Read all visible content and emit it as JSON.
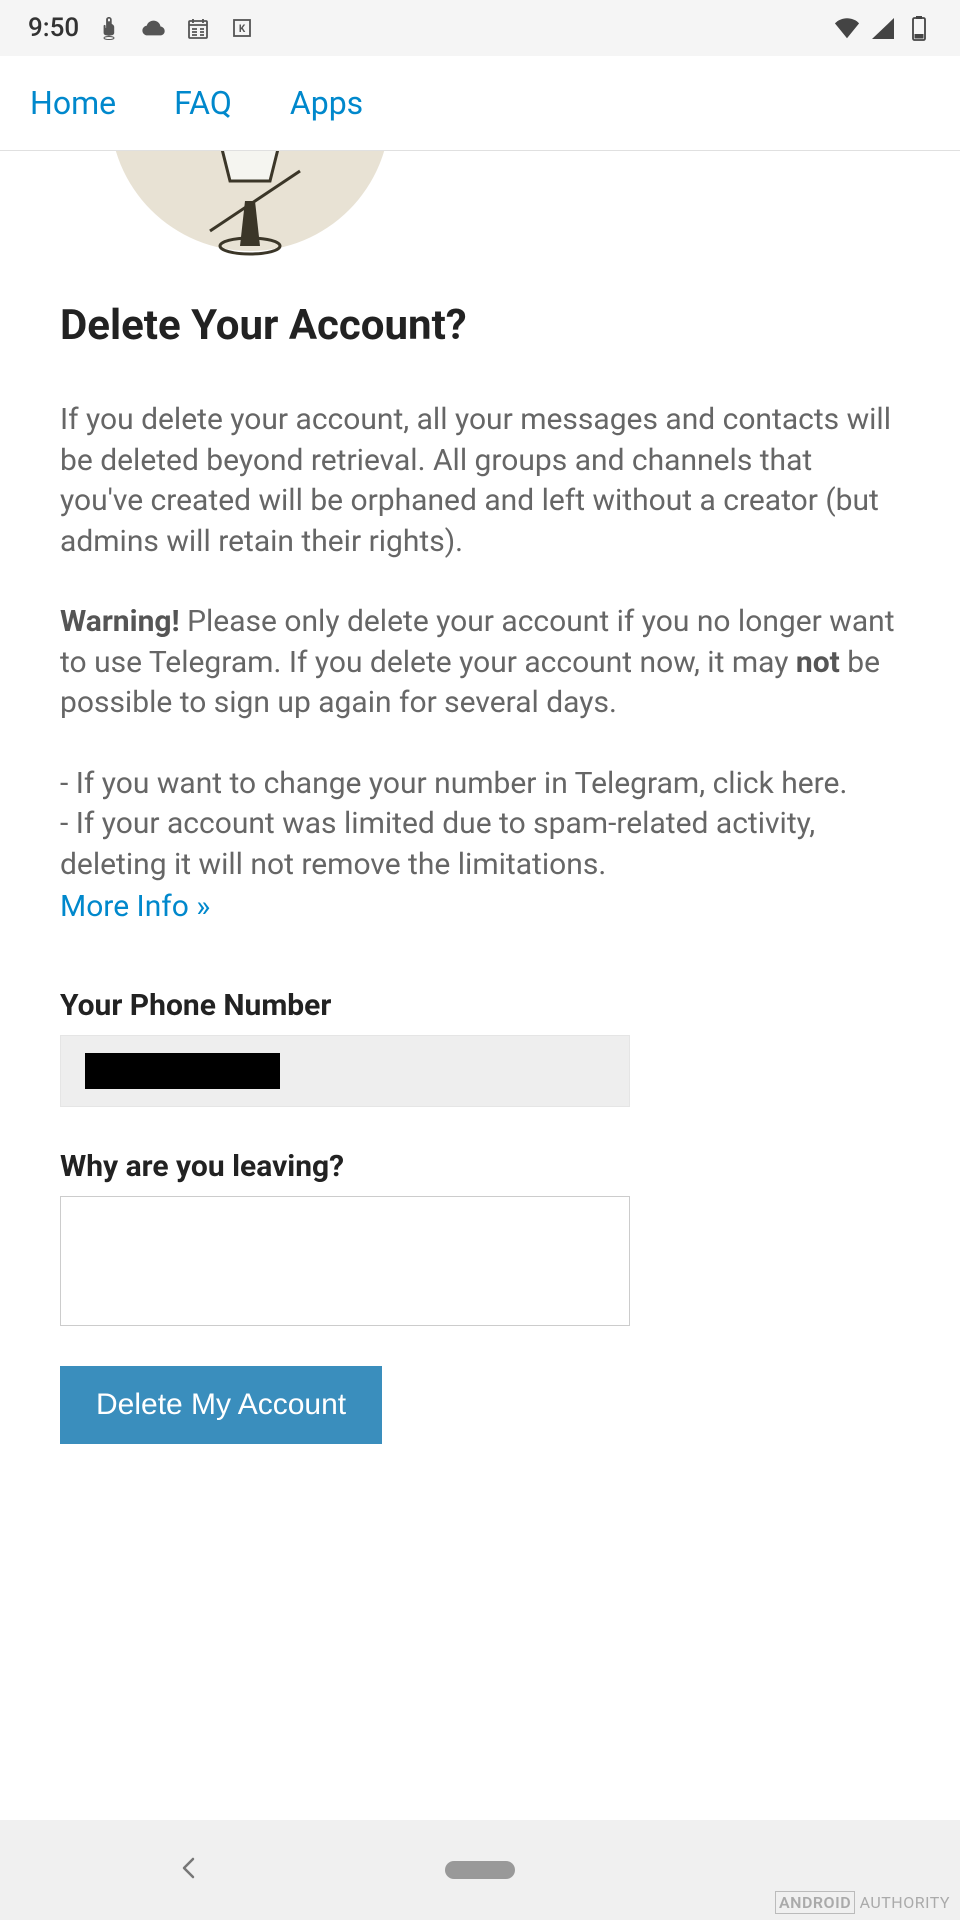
{
  "status": {
    "time": "9:50",
    "icons_left": [
      "touch-icon",
      "cloud-icon",
      "calendar-icon",
      "app-icon"
    ],
    "icons_right": [
      "wifi-icon",
      "signal-icon",
      "battery-icon"
    ]
  },
  "nav": {
    "home": "Home",
    "faq": "FAQ",
    "apps": "Apps"
  },
  "page": {
    "title": "Delete Your Account?",
    "p1": "If you delete your account, all your messages and contacts will be deleted beyond retrieval. All groups and channels that you've created will be orphaned and left without a creator (but admins will retain their rights).",
    "warning_label": "Warning!",
    "p2a": " Please only delete your account if you no longer want to use Telegram. If you delete your account now, it may ",
    "p2_not": "not",
    "p2b": " be possible to sign up again for several days.",
    "b1a": "- If you want to change your number in Telegram, ",
    "b1_link": "click here",
    "b1b": ".",
    "b2a": "- If your account was limited due to spam-related activity, deleting it will ",
    "b2_not": "not",
    "b2b": " remove the limitations.",
    "more_info": "More Info »"
  },
  "form": {
    "phone_label": "Your Phone Number",
    "phone_value": "",
    "reason_label": "Why are you leaving?",
    "reason_value": "",
    "submit_label": "Delete My Account"
  },
  "watermark": {
    "brand": "ANDROID",
    "suffix": "AUTHORITY"
  }
}
